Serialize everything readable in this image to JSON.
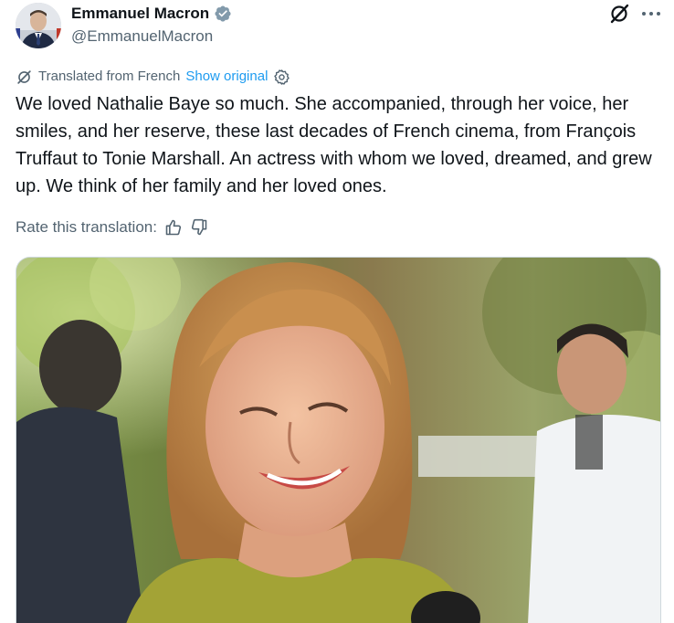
{
  "author": {
    "display_name": "Emmanuel Macron",
    "handle": "@EmmanuelMacron",
    "verified_icon": "verified-badge-icon",
    "avatar_icon": "avatar"
  },
  "actions": {
    "grok_icon": "grok-icon",
    "more_icon": "more-icon"
  },
  "translation": {
    "label": "Translated from French",
    "show_original": "Show original",
    "settings_icon": "gear-icon"
  },
  "tweet": {
    "text": "We loved Nathalie Baye so much. She accompanied, through her voice, her smiles, and her reserve, these last decades of French cinema, from François Truffaut to Tonie Marshall. An actress with whom we loved, dreamed, and grew up. We think of her family and her loved ones."
  },
  "rating": {
    "label": "Rate this translation:",
    "thumbs_up_icon": "thumbs-up-icon",
    "thumbs_down_icon": "thumbs-down-icon"
  },
  "colors": {
    "accent": "#1d9bf0",
    "text_primary": "#0f1419",
    "text_secondary": "#536471",
    "verified": "#829aab"
  }
}
